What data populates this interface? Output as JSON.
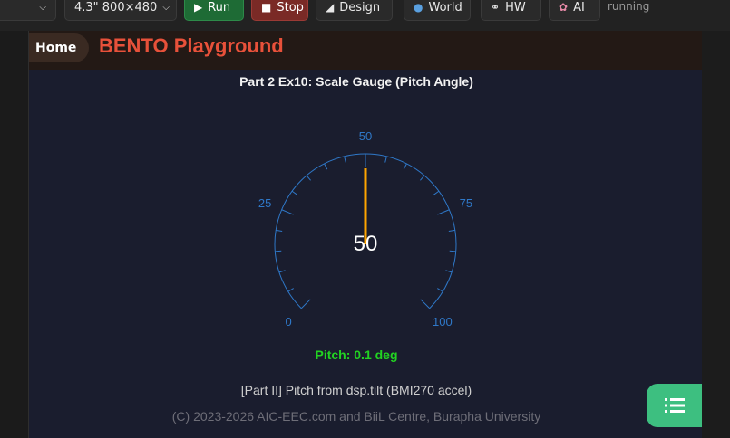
{
  "toolbar": {
    "display_select": "4.3\" 800×480",
    "run_label": "Run",
    "stop_label": "Stop",
    "design_label": "Design",
    "world_label": "World",
    "hw_label": "HW",
    "ai_label": "AI",
    "status": "running"
  },
  "header": {
    "home_label": "Home",
    "title": "BENTO Playground"
  },
  "gauge": {
    "title": "Part 2 Ex10: Scale Gauge (Pitch Angle)",
    "min": 0,
    "max": 100,
    "value": 50,
    "value_text": "50",
    "labels": [
      "0",
      "25",
      "50",
      "75",
      "100"
    ],
    "colors": {
      "scale": "#2f78c8",
      "needle": "#ffa500",
      "value_text": "#ffffff"
    }
  },
  "readout": {
    "pitch_text": "Pitch: 0.1 deg"
  },
  "footer": {
    "part_text": "[Part II] Pitch from dsp.tilt (BMI270 accel)",
    "copyright": "(C) 2023-2026 AIC-EEC.com and BiiL Centre, Burapha University"
  },
  "fab": {
    "icon": "list-icon"
  }
}
